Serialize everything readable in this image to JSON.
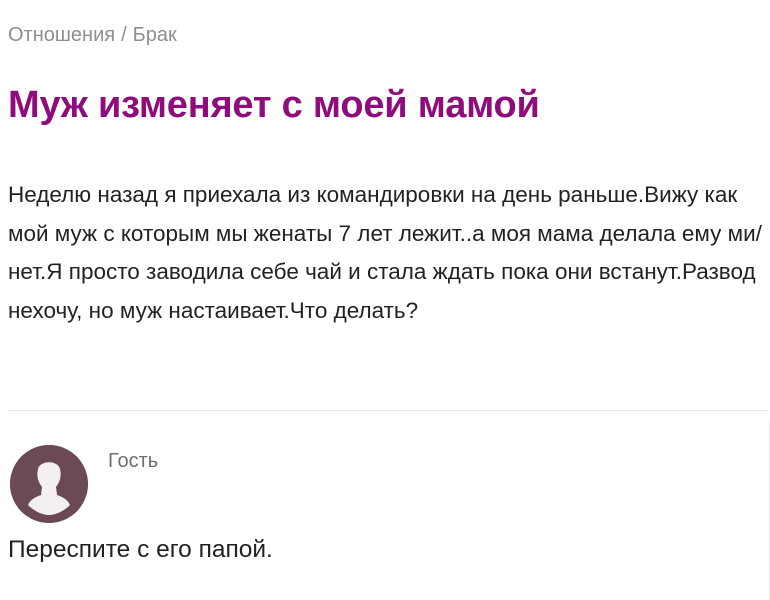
{
  "breadcrumb": {
    "items": [
      "Отношения",
      "Брак"
    ],
    "separator": "/"
  },
  "post": {
    "title": "Муж изменяет с моей мамой",
    "body": "Неделю назад я приехала из командировки на день раньше.Вижу как мой муж с которым мы женаты 7 лет лежит..а моя мама делала ему ми/нет.Я просто заводила себе чай и стала ждать пока они встанут.Развод нехочу, но муж настаивает.Что делать?"
  },
  "comment": {
    "author": "Гость",
    "avatar_icon": "user-silhouette-icon",
    "text": "Переспите с его папой."
  },
  "colors": {
    "title": "#8e0c7c",
    "breadcrumb": "#8e8e8e",
    "avatar_bg": "#6b4a55"
  }
}
